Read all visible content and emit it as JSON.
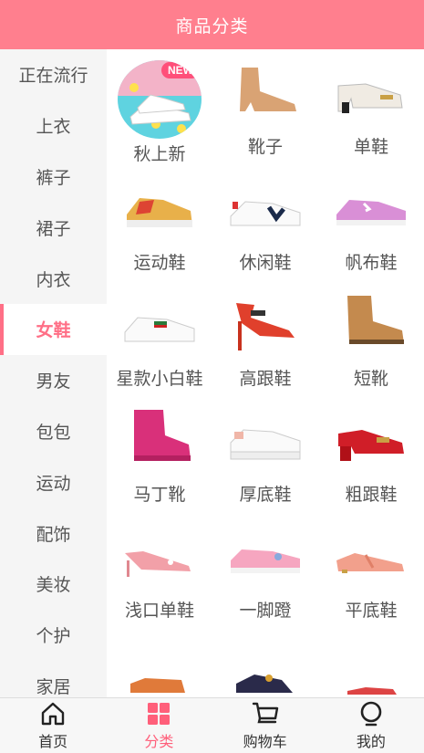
{
  "header": {
    "title": "商品分类"
  },
  "sidebar": {
    "items": [
      {
        "label": "正在流行"
      },
      {
        "label": "上衣"
      },
      {
        "label": "裤子"
      },
      {
        "label": "裙子"
      },
      {
        "label": "内衣"
      },
      {
        "label": "女鞋"
      },
      {
        "label": "男友"
      },
      {
        "label": "包包"
      },
      {
        "label": "运动"
      },
      {
        "label": "配饰"
      },
      {
        "label": "美妆"
      },
      {
        "label": "个护"
      },
      {
        "label": "家居"
      }
    ],
    "active_index": 5
  },
  "products": [
    {
      "label": "秋上新",
      "icon": "new-arrivals-image",
      "badge": "NEW"
    },
    {
      "label": "靴子",
      "icon": "ankle-boot-image"
    },
    {
      "label": "单鞋",
      "icon": "loafer-image"
    },
    {
      "label": "运动鞋",
      "icon": "sneaker-image"
    },
    {
      "label": "休闲鞋",
      "icon": "casual-shoe-image"
    },
    {
      "label": "帆布鞋",
      "icon": "canvas-shoe-image"
    },
    {
      "label": "星款小白鞋",
      "icon": "white-sneaker-image"
    },
    {
      "label": "高跟鞋",
      "icon": "high-heel-image"
    },
    {
      "label": "短靴",
      "icon": "chelsea-boot-image"
    },
    {
      "label": "马丁靴",
      "icon": "martin-boot-image"
    },
    {
      "label": "厚底鞋",
      "icon": "platform-shoe-image"
    },
    {
      "label": "粗跟鞋",
      "icon": "block-heel-image"
    },
    {
      "label": "浅口单鞋",
      "icon": "pump-image"
    },
    {
      "label": "一脚蹬",
      "icon": "slip-on-image"
    },
    {
      "label": "平底鞋",
      "icon": "flat-shoe-image"
    },
    {
      "label": "",
      "icon": "shoe-image"
    },
    {
      "label": "",
      "icon": "shoe-image"
    },
    {
      "label": "",
      "icon": "shoe-image"
    }
  ],
  "tabbar": {
    "items": [
      {
        "label": "首页",
        "icon": "home-icon"
      },
      {
        "label": "分类",
        "icon": "category-icon"
      },
      {
        "label": "购物车",
        "icon": "cart-icon"
      },
      {
        "label": "我的",
        "icon": "profile-icon"
      }
    ],
    "active_index": 1
  },
  "colors": {
    "header": "#ff7f8e",
    "accent": "#ff6f86"
  }
}
